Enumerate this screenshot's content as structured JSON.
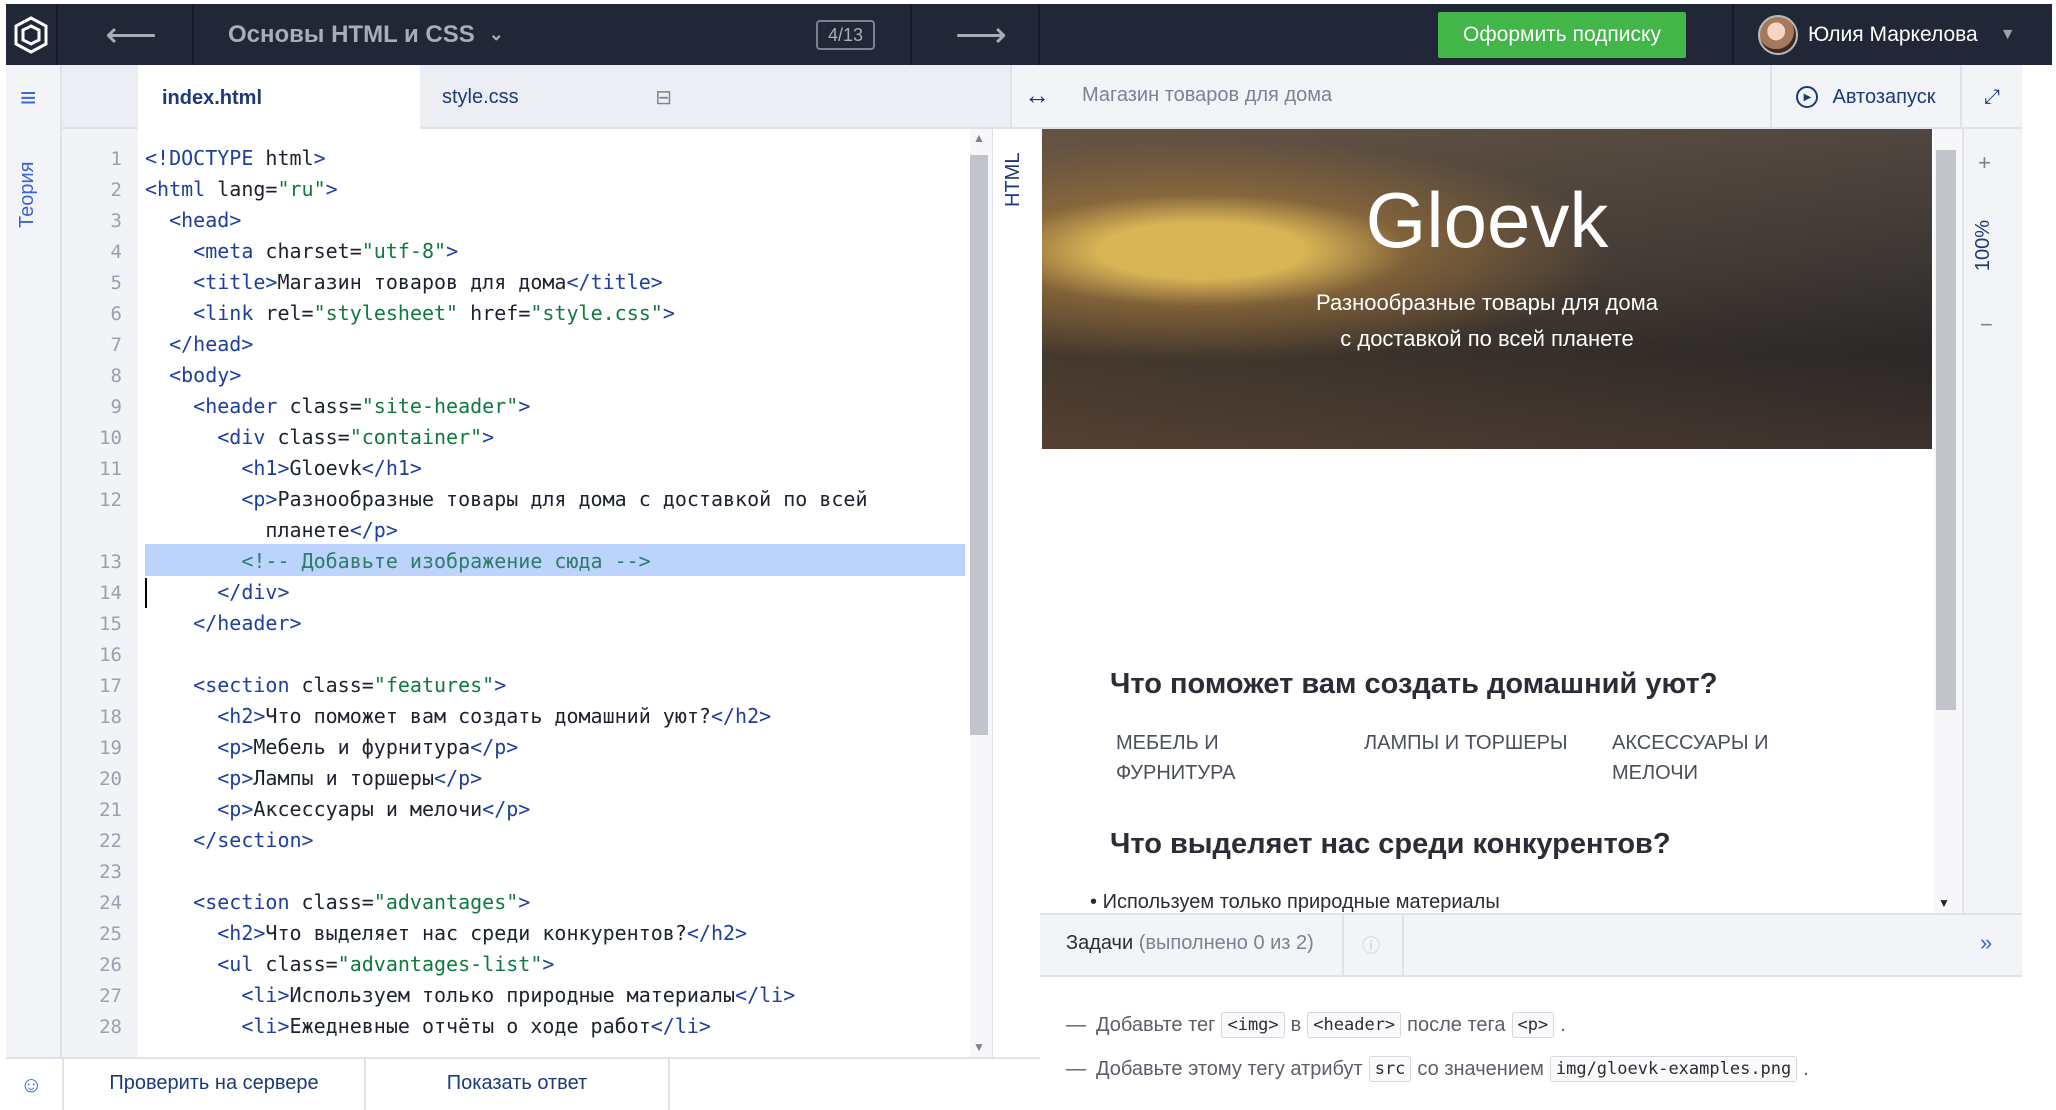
{
  "topbar": {
    "course_title": "Основы HTML и CSS",
    "progress": "4/13",
    "subscribe_label": "Оформить подписку",
    "user_name": "Юлия Маркелова"
  },
  "sidebar": {
    "theory_label": "Теория"
  },
  "tabs": [
    {
      "label": "index.html"
    },
    {
      "label": "style.css"
    }
  ],
  "editor": {
    "side_label": "HTML",
    "line_numbers": [
      "1",
      "2",
      "3",
      "4",
      "5",
      "6",
      "7",
      "8",
      "9",
      "10",
      "11",
      "12",
      "13",
      "14",
      "15",
      "16",
      "17",
      "18",
      "19",
      "20",
      "21",
      "22",
      "23",
      "24",
      "25",
      "26",
      "27",
      "28"
    ],
    "lines": [
      "<!DOCTYPE html>",
      "<html lang=\"ru\">",
      "  <head>",
      "    <meta charset=\"utf-8\">",
      "    <title>Магазин товаров для дома</title>",
      "    <link rel=\"stylesheet\" href=\"style.css\">",
      "  </head>",
      "  <body>",
      "    <header class=\"site-header\">",
      "      <div class=\"container\">",
      "        <h1>Gloevk</h1>",
      "        <p>Разнообразные товары для дома с доставкой по всей",
      "          планете</p>",
      "        <!-- Добавьте изображение сюда -->",
      "      </div>",
      "    </header>",
      "",
      "    <section class=\"features\">",
      "      <h2>Что поможет вам создать домашний уют?</h2>",
      "      <p>Мебель и фурнитура</p>",
      "      <p>Лампы и торшеры</p>",
      "      <p>Аксессуары и мелочи</p>",
      "    </section>",
      "",
      "    <section class=\"advantages\">",
      "      <h2>Что выделяет нас среди конкурентов?</h2>",
      "      <ul class=\"advantages-list\">",
      "        <li>Используем только природные материалы</li>",
      "        <li>Ежедневные отчёты о ходе работ</li>"
    ]
  },
  "preview": {
    "title": "Магазин товаров для дома",
    "autorun_label": "Автозапуск",
    "zoom": "100%",
    "hero_title": "Gloevk",
    "hero_subtitle_1": "Разнообразные товары для дома",
    "hero_subtitle_2": "с доставкой по всей планете",
    "features_heading": "Что поможет вам создать домашний уют?",
    "features": [
      {
        "line1": "МЕБЕЛЬ И",
        "line2": "ФУРНИТУРА"
      },
      {
        "line1": "ЛАМПЫ И ТОРШЕРЫ",
        "line2": ""
      },
      {
        "line1": "АКСЕССУАРЫ И",
        "line2": "МЕЛОЧИ"
      }
    ],
    "advantages_heading": "Что выделяет нас среди конкурентов?",
    "advantages_first_item": "Используем только природные материалы"
  },
  "tasks": {
    "label": "Задачи",
    "count": "(выполнено 0 из 2)",
    "items": [
      {
        "prefix": "Добавьте тег",
        "code1": "<img>",
        "mid": "в",
        "code2": "<header>",
        "mid2": "после тега",
        "code3": "<p>",
        "suffix": "."
      },
      {
        "prefix": "Добавьте этому тегу атрибут",
        "code1": "src",
        "mid": "со значением",
        "code2": "img/gloevk-examples.png",
        "suffix": "."
      }
    ]
  },
  "bottom": {
    "check_label": "Проверить на сервере",
    "answer_label": "Показать ответ"
  },
  "colors": {
    "topbar": "#222738",
    "accent": "#3b64d8",
    "subscribe": "#43b649",
    "highlight": "#bcd3fb"
  }
}
